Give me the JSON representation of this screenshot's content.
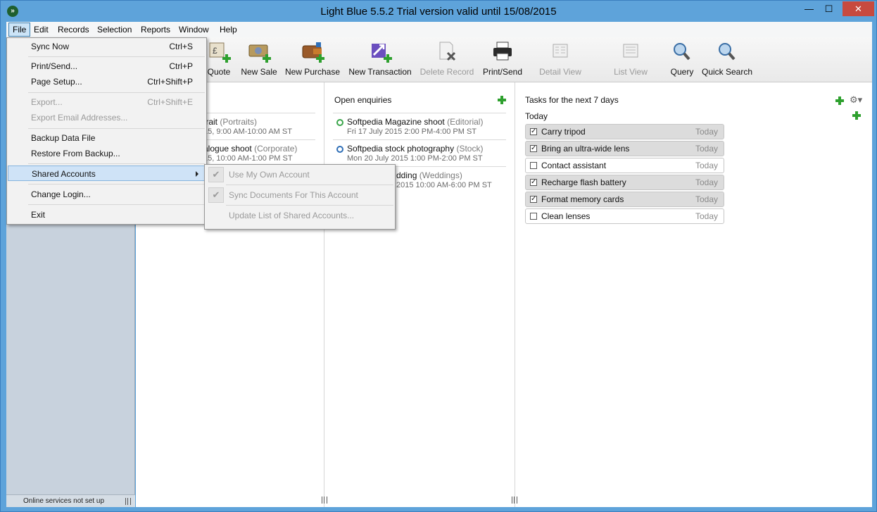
{
  "window": {
    "title": "Light Blue 5.5.2   Trial version valid until 15/08/2015",
    "minimize": "—",
    "maximize": "☐",
    "close": "✕",
    "app_icon": "»"
  },
  "menubar": [
    "File",
    "Edit",
    "Records",
    "Selection",
    "Reports",
    "Window",
    "Help"
  ],
  "toolbar": [
    {
      "label": "Quote",
      "icon": "quote-icon",
      "enabled": true
    },
    {
      "label": "New Sale",
      "icon": "new-sale-icon",
      "enabled": true
    },
    {
      "label": "New Purchase",
      "icon": "new-purchase-icon",
      "enabled": true
    },
    {
      "label": "New Transaction",
      "icon": "new-transaction-icon",
      "enabled": true
    },
    {
      "label": "Delete Record",
      "icon": "delete-record-icon",
      "enabled": false
    },
    {
      "label": "Print/Send",
      "icon": "printer-icon",
      "enabled": true
    },
    {
      "label": "Detail View",
      "icon": "detail-view-icon",
      "enabled": false
    },
    {
      "label": "List View",
      "icon": "list-view-icon",
      "enabled": false
    },
    {
      "label": "Query",
      "icon": "magnifier-icon",
      "enabled": true
    },
    {
      "label": "Quick Search",
      "icon": "magnifier-icon",
      "enabled": true
    }
  ],
  "sidebar": {
    "status": "Online services not set up"
  },
  "left_panel": {
    "items": [
      {
        "title_visible": "trait",
        "category": "(Portraits)",
        "date_visible": "15, 9:00 AM-10:00 AM ST"
      },
      {
        "title_visible": "alogue shoot",
        "category": "(Corporate)",
        "date_visible": "15, 10:00 AM-1:00 PM ST"
      }
    ]
  },
  "open_enquiries": {
    "title": "Open enquiries",
    "items": [
      {
        "title": "Softpedia Magazine shoot",
        "category": "(Editorial)",
        "date": "Fri 17 July 2015 2:00 PM-4:00 PM ST",
        "dot_color": "#3aa54a"
      },
      {
        "title": "Softpedia stock photography",
        "category": "(Stock)",
        "date": "Mon 20 July 2015 1:00 PM-2:00 PM ST",
        "dot_color": "#2f6fb7"
      },
      {
        "title_visible": "dding",
        "category": "(Weddings)",
        "date_visible": "2015 10:00 AM-6:00 PM ST"
      }
    ]
  },
  "tasks": {
    "title": "Tasks for the next 7 days",
    "group": "Today",
    "items": [
      {
        "label": "Carry tripod",
        "due": "Today",
        "done": true
      },
      {
        "label": "Bring an ultra-wide lens",
        "due": "Today",
        "done": true
      },
      {
        "label": "Contact assistant",
        "due": "Today",
        "done": false
      },
      {
        "label": "Recharge flash battery",
        "due": "Today",
        "done": true
      },
      {
        "label": "Format memory cards",
        "due": "Today",
        "done": true
      },
      {
        "label": "Clean lenses",
        "due": "Today",
        "done": false
      }
    ]
  },
  "file_menu": [
    {
      "label": "Sync Now",
      "shortcut": "Ctrl+S",
      "enabled": true
    },
    {
      "label": "Print/Send...",
      "shortcut": "Ctrl+P",
      "enabled": true
    },
    {
      "label": "Page Setup...",
      "shortcut": "Ctrl+Shift+P",
      "enabled": true
    },
    {
      "label": "Export...",
      "shortcut": "Ctrl+Shift+E",
      "enabled": false
    },
    {
      "label": "Export Email Addresses...",
      "shortcut": "",
      "enabled": false
    },
    {
      "label": "Backup Data File",
      "shortcut": "",
      "enabled": true
    },
    {
      "label": "Restore From Backup...",
      "shortcut": "",
      "enabled": true
    },
    {
      "label": "Shared Accounts",
      "shortcut": "",
      "enabled": true,
      "submenu": true
    },
    {
      "label": "Change Login...",
      "shortcut": "",
      "enabled": true
    },
    {
      "label": "Exit",
      "shortcut": "",
      "enabled": true
    }
  ],
  "shared_accounts_menu": [
    {
      "label": "Use My Own Account",
      "checked": true
    },
    {
      "label": "Sync Documents For This Account",
      "checked": true
    },
    {
      "label": "Update List of Shared Accounts...",
      "checked": false
    }
  ],
  "colors": {
    "titlebar": "#5ea3da",
    "close_button": "#c74a3f",
    "add_green": "#2ea02e",
    "menu_highlight": "#cfe3f7"
  }
}
